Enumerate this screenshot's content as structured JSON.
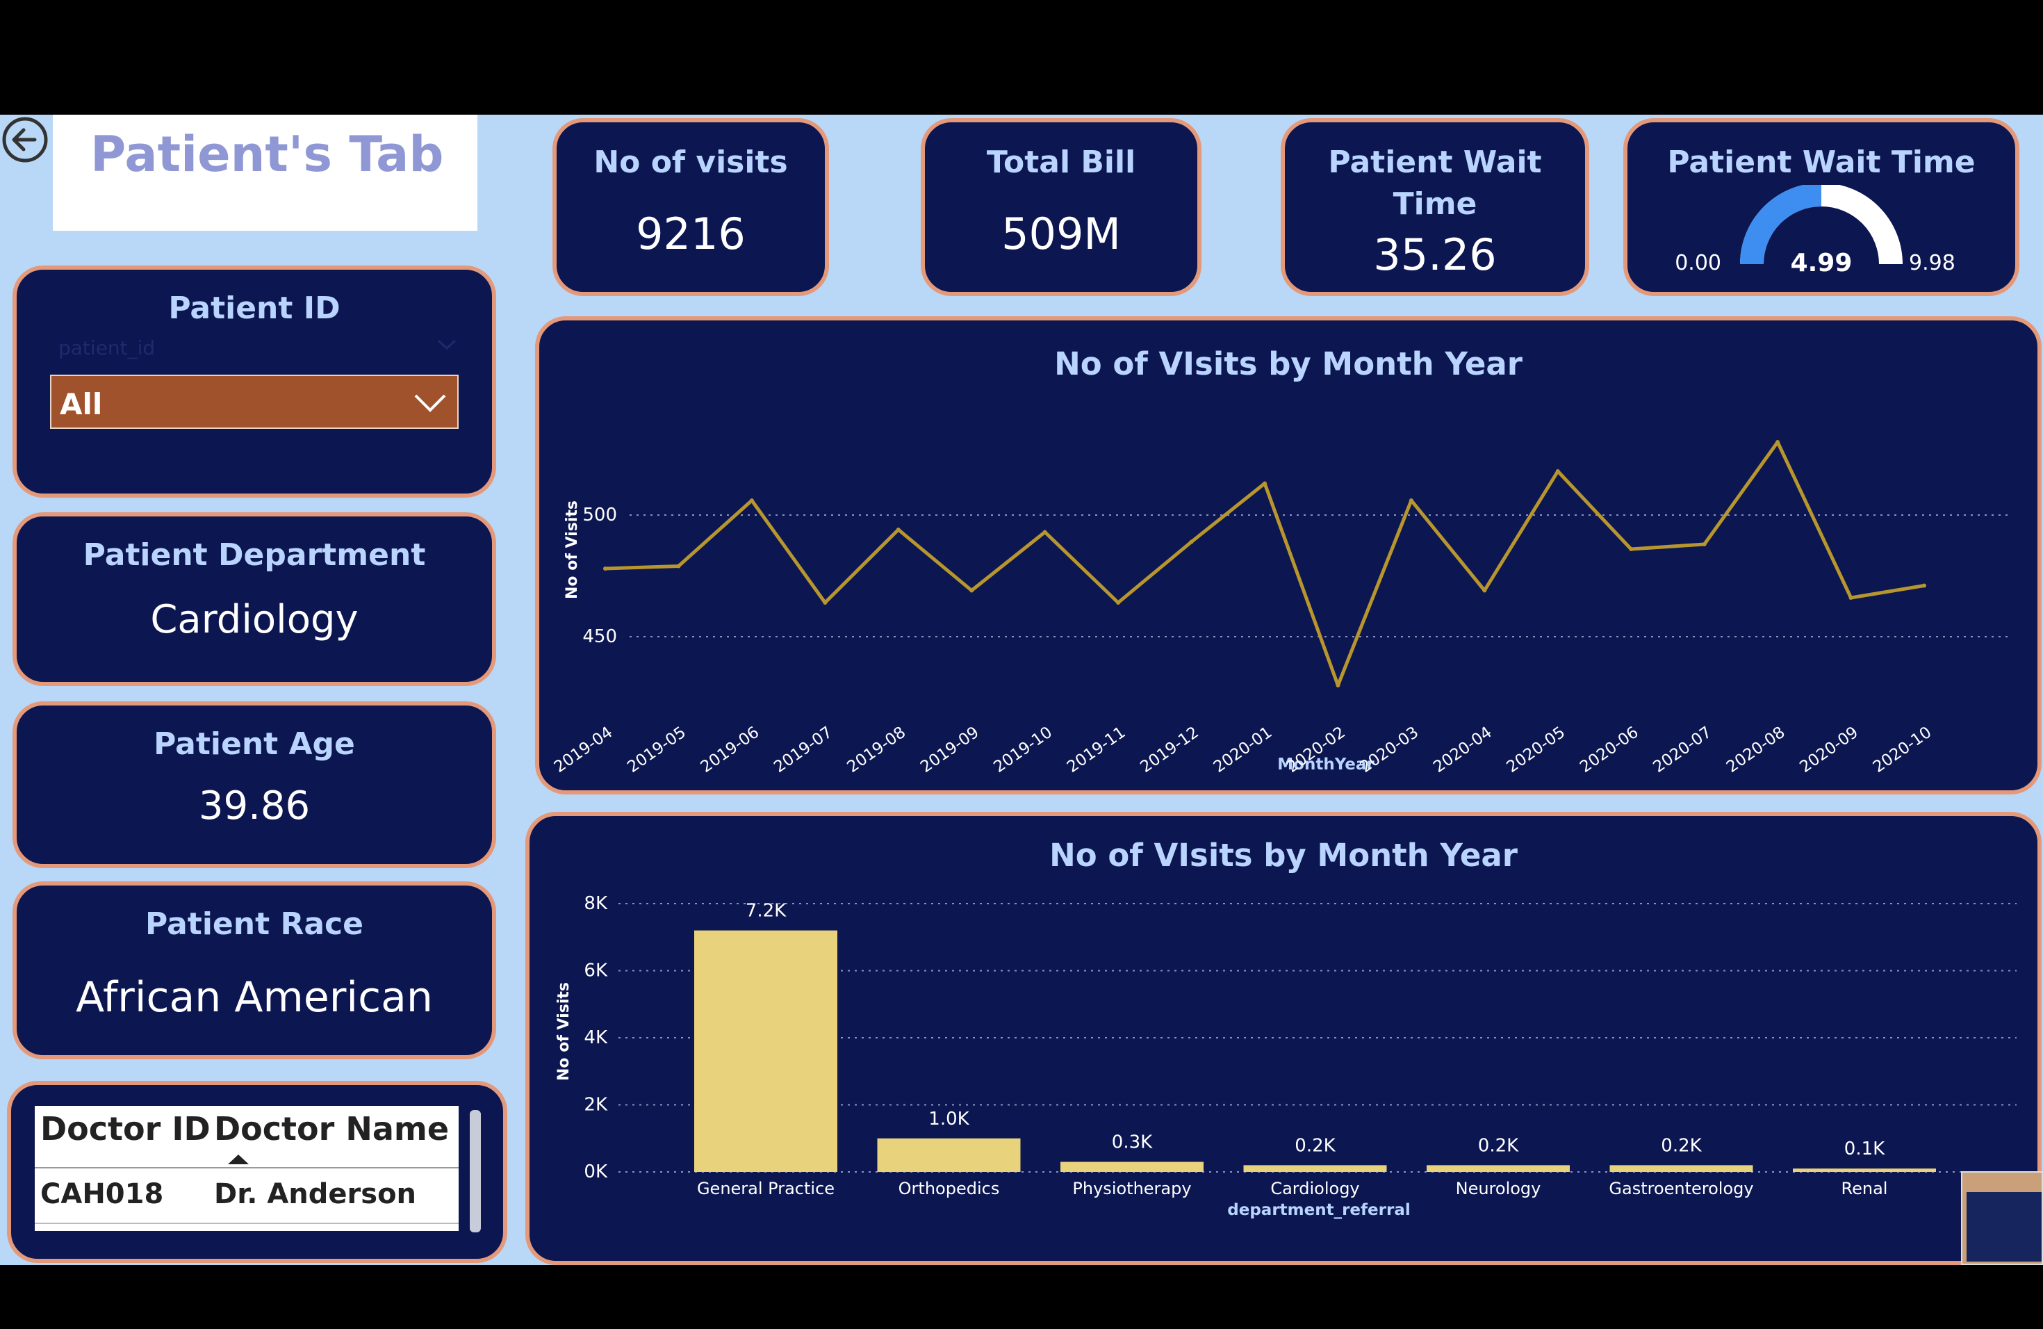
{
  "back_icon": "back-arrow-circle-icon",
  "page_title": "Patient's Tab",
  "kpis": {
    "visits": {
      "title": "No of visits",
      "value": "9216"
    },
    "bill": {
      "title": "Total Bill",
      "value": "509M"
    },
    "wait": {
      "title_line1": "Patient Wait",
      "title_line2": "Time",
      "value": "35.26"
    },
    "gauge": {
      "title": "Patient Wait Time",
      "min_label": "0.00",
      "value_label": "4.99",
      "max_label": "9.98",
      "min": 0,
      "value": 4.99,
      "max": 9.98,
      "fill_color": "#3d8ef0",
      "track_color": "#ffffff"
    }
  },
  "filters": {
    "patient_id": {
      "title": "Patient ID",
      "placeholder": "patient_id",
      "selected": "All"
    }
  },
  "cards": {
    "department": {
      "title": "Patient Department",
      "value": "Cardiology"
    },
    "age": {
      "title": "Patient Age",
      "value": "39.86"
    },
    "race": {
      "title": "Patient Race",
      "value": "African American"
    }
  },
  "doctor_table": {
    "headers": [
      "Doctor ID",
      "Doctor Name"
    ],
    "rows": [
      [
        "CAH018",
        "Dr. Anderson"
      ]
    ]
  },
  "colors": {
    "background": "#b9d8f7",
    "card": "#0c1650",
    "card_border": "#e4997a",
    "line": "#b8962e",
    "bar": "#e8d27c",
    "dropdown": "#a0522d"
  },
  "chart_data": [
    {
      "type": "line",
      "title": "No of VIsits by Month Year",
      "xlabel": "MonthYear",
      "ylabel": "No of Visits",
      "x": [
        "2019-04",
        "2019-05",
        "2019-06",
        "2019-07",
        "2019-08",
        "2019-09",
        "2019-10",
        "2019-11",
        "2019-12",
        "2020-01",
        "2020-02",
        "2020-03",
        "2020-04",
        "2020-05",
        "2020-06",
        "2020-07",
        "2020-08",
        "2020-09",
        "2020-10"
      ],
      "values": [
        478,
        479,
        506,
        464,
        494,
        469,
        493,
        464,
        489,
        513,
        430,
        506,
        469,
        518,
        486,
        488,
        530,
        466,
        471
      ],
      "yticks": [
        "450",
        "500"
      ],
      "ylim": [
        420,
        540
      ],
      "grid": true
    },
    {
      "type": "bar",
      "title": "No of VIsits by Month Year",
      "xlabel": "department_referral",
      "ylabel": "No of Visits",
      "categories": [
        "General Practice",
        "Orthopedics",
        "Physiotherapy",
        "Cardiology",
        "Neurology",
        "Gastroenterology",
        "Renal"
      ],
      "values": [
        7200,
        1000,
        300,
        200,
        200,
        200,
        100
      ],
      "data_labels": [
        "7.2K",
        "1.0K",
        "0.3K",
        "0.2K",
        "0.2K",
        "0.2K",
        "0.1K"
      ],
      "yticks": [
        "0K",
        "2K",
        "4K",
        "6K",
        "8K"
      ],
      "ylim": [
        0,
        8000
      ],
      "grid": true
    }
  ]
}
